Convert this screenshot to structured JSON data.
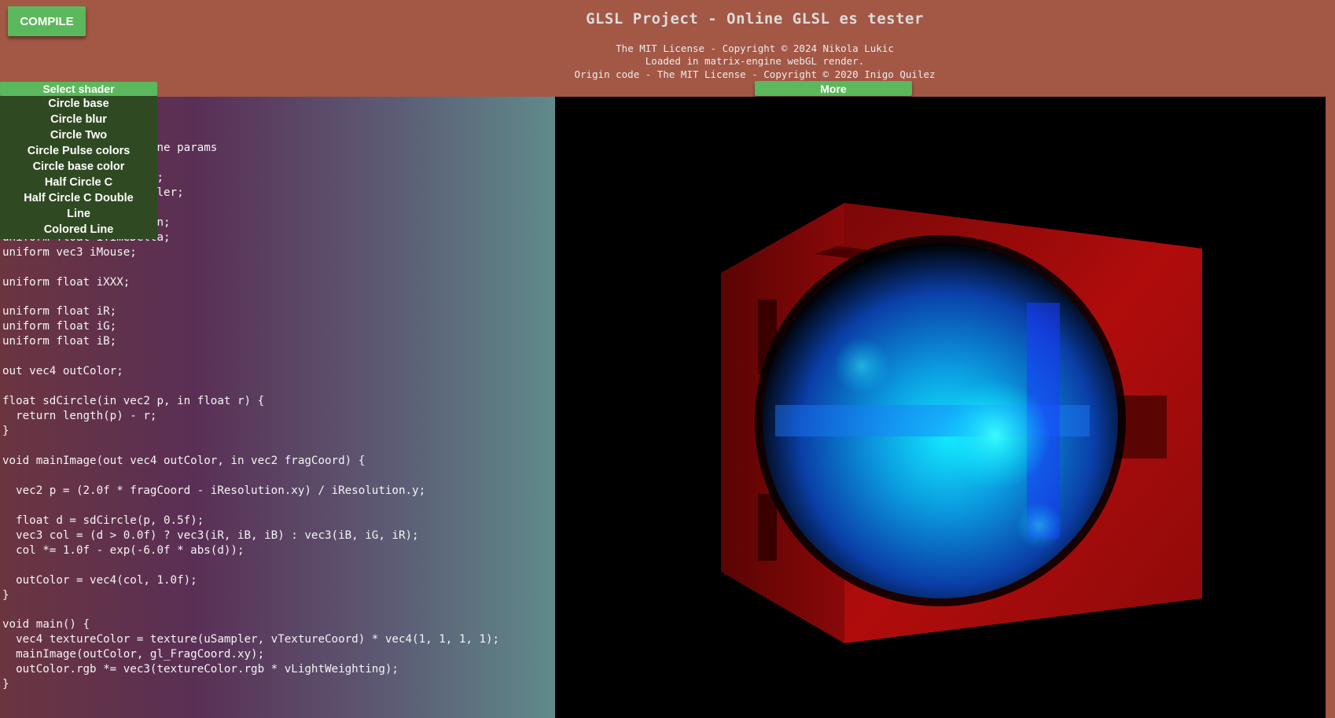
{
  "toolbar": {
    "compile_label": "COMPILE",
    "more_label": "More"
  },
  "header": {
    "title": "GLSL Project - Online GLSL es tester",
    "license_lines": [
      "The MIT License - Copyright © 2024 Nikola Lukic",
      "Loaded in matrix-engine webGL render.",
      "Origin code - The MIT License - Copyright © 2020 Inigo Quilez"
    ]
  },
  "shader_select": {
    "label": "Select shader",
    "items": [
      "Circle base",
      "Circle blur",
      "Circle Two",
      "Circle Pulse colors",
      "Circle base color",
      "Half Circle C",
      "Half Circle C Double",
      "Line",
      "Colored Line"
    ]
  },
  "editor": {
    "code_lines": [
      "",
      "                      ine params",
      "",
      "                      g;",
      "                      pler;",
      "",
      "                      on;",
      "uniform float iTimeDelta;",
      "uniform vec3 iMouse;",
      "",
      "uniform float iXXX;",
      "",
      "uniform float iR;",
      "uniform float iG;",
      "uniform float iB;",
      "",
      "out vec4 outColor;",
      "",
      "float sdCircle(in vec2 p, in float r) {",
      "  return length(p) - r;",
      "}",
      "",
      "void mainImage(out vec4 outColor, in vec2 fragCoord) {",
      "",
      "  vec2 p = (2.0f * fragCoord - iResolution.xy) / iResolution.y;",
      "",
      "  float d = sdCircle(p, 0.5f);",
      "  vec3 col = (d > 0.0f) ? vec3(iR, iB, iB) : vec3(iB, iG, iR);",
      "  col *= 1.0f - exp(-6.0f * abs(d));",
      "",
      "  outColor = vec4(col, 1.0f);",
      "}",
      "",
      "void main() {",
      "  vec4 textureColor = texture(uSampler, vTextureCoord) * vec4(1, 1, 1, 1);",
      "  mainImage(outColor, gl_FragCoord.xy);",
      "  outColor.rgb *= vec3(textureColor.rgb * vLightWeighting);",
      "}"
    ]
  },
  "viewport": {
    "colors": {
      "background": "#000000",
      "cube": "#b00c0c",
      "sphere_glow": "#00e5ff",
      "sphere_core": "#1e6cff"
    }
  }
}
